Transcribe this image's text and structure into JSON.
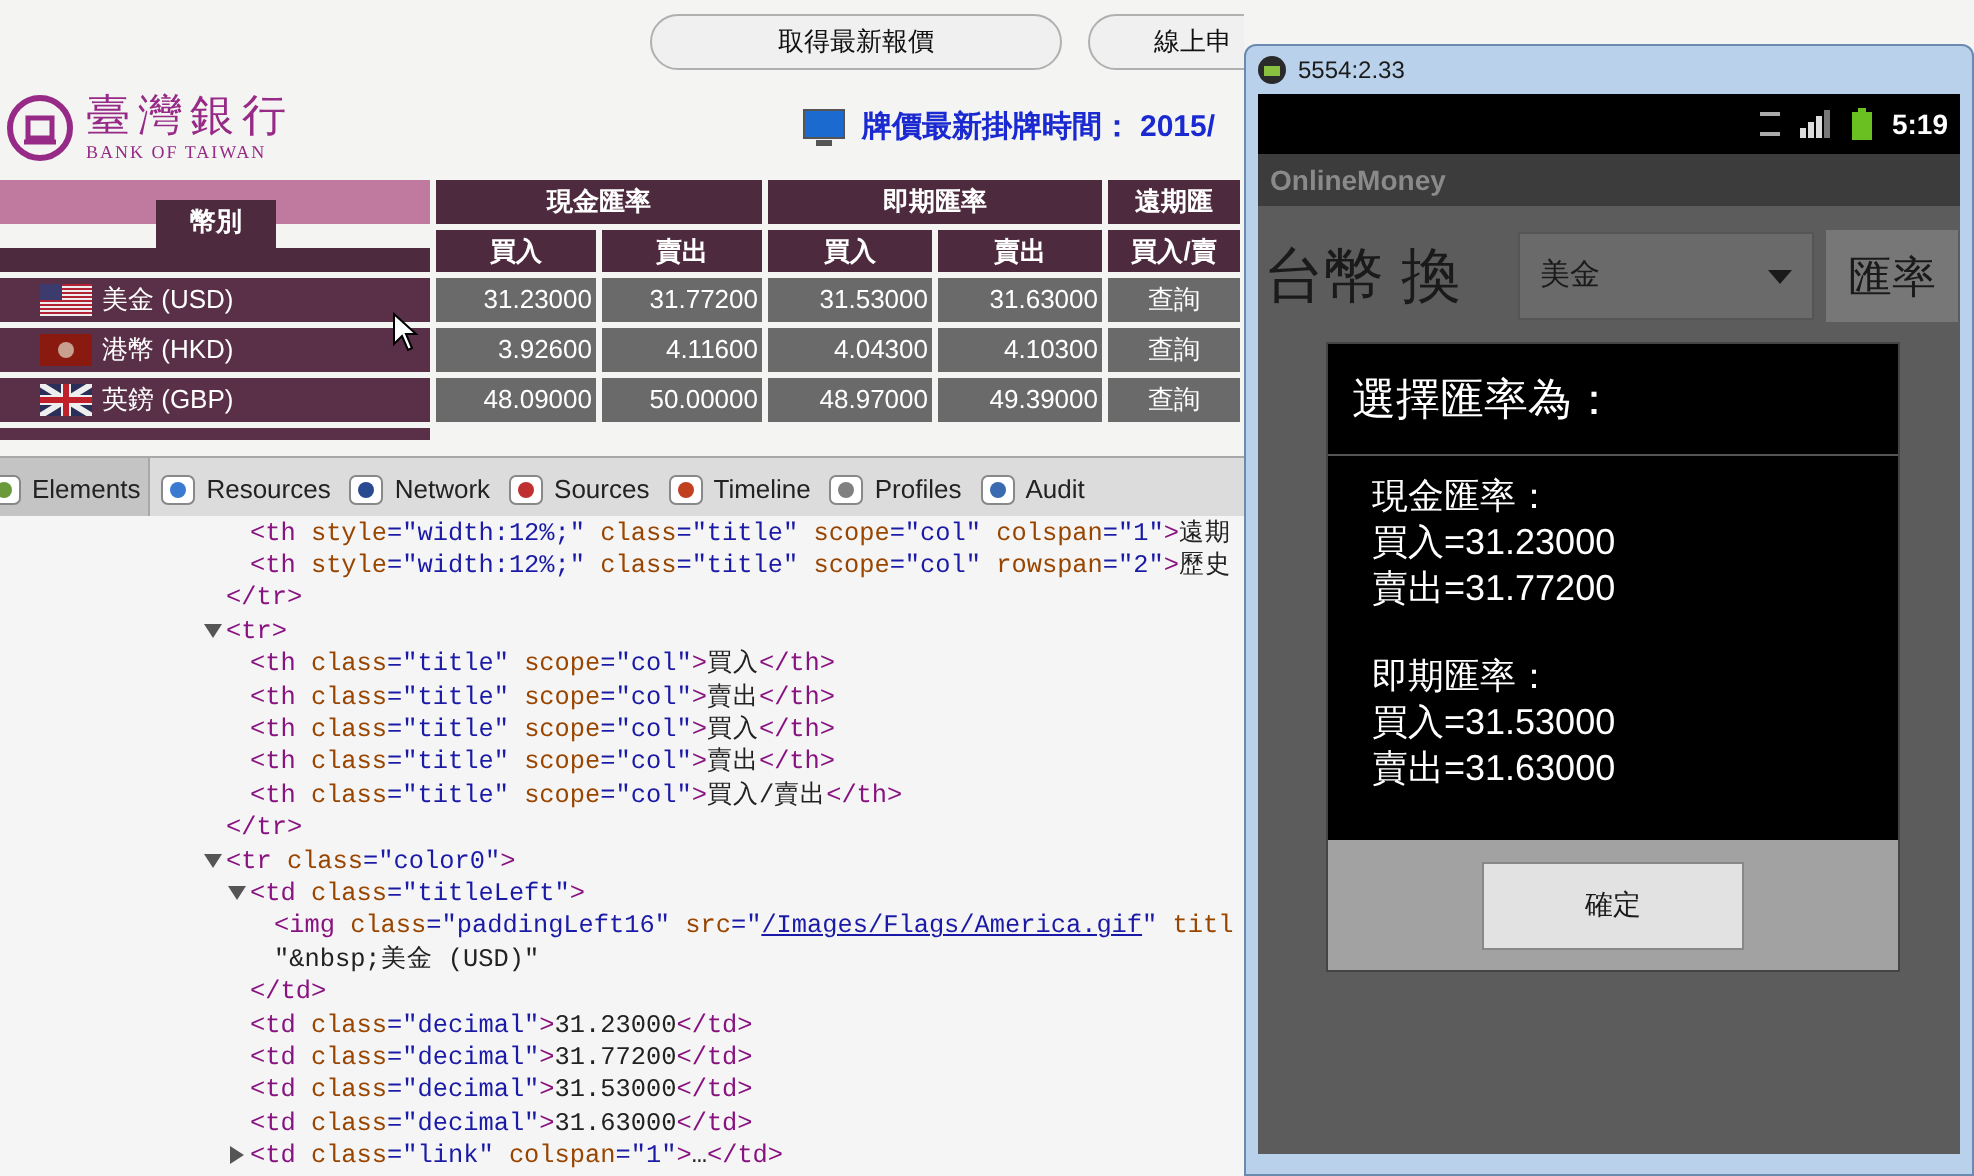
{
  "browser": {
    "buttons": [
      {
        "label": "取得最新報價"
      },
      {
        "label": "線上申"
      }
    ],
    "logo": {
      "name": "臺灣銀行",
      "subtitle": "BANK OF TAIWAN"
    },
    "update_time": {
      "label": "牌價最新掛牌時間：",
      "value": "2015/"
    },
    "rate_table": {
      "currency_header": "幣別",
      "groups": [
        {
          "label": "現金匯率",
          "columns": [
            "買入",
            "賣出"
          ]
        },
        {
          "label": "即期匯率",
          "columns": [
            "買入",
            "賣出"
          ]
        },
        {
          "label": "遠期匯",
          "columns": [
            "買入/賣"
          ]
        }
      ],
      "rows": [
        {
          "currency": "美金 (USD)",
          "kind": "us",
          "values": [
            "31.23000",
            "31.77200",
            "31.53000",
            "31.63000"
          ],
          "link": "查詢"
        },
        {
          "currency": "港幣 (HKD)",
          "kind": "hk",
          "values": [
            "3.92600",
            "4.11600",
            "4.04300",
            "4.10300"
          ],
          "link": "查詢"
        },
        {
          "currency": "英鎊 (GBP)",
          "kind": "gb",
          "values": [
            "48.09000",
            "50.00000",
            "48.97000",
            "49.39000"
          ],
          "link": "查詢"
        }
      ]
    }
  },
  "devtools": {
    "tabs": [
      {
        "label": "Elements",
        "selected": true
      },
      {
        "label": "Resources",
        "selected": false
      },
      {
        "label": "Network",
        "selected": false
      },
      {
        "label": "Sources",
        "selected": false
      },
      {
        "label": "Timeline",
        "selected": false
      },
      {
        "label": "Profiles",
        "selected": false
      },
      {
        "label": "Audit",
        "selected": false
      }
    ],
    "tree": [
      {
        "children": [
          {
            "tokens": [
              {
                "kind": "tag",
                "text": "<th"
              },
              {
                "kind": "attr",
                "text": " style"
              },
              {
                "kind": "value",
                "text": "=\"width:12%;\""
              },
              {
                "kind": "attr",
                "text": " class"
              },
              {
                "kind": "value",
                "text": "=\"title\""
              },
              {
                "kind": "attr",
                "text": " scope"
              },
              {
                "kind": "value",
                "text": "=\"col\""
              },
              {
                "kind": "attr",
                "text": " colspan"
              },
              {
                "kind": "value",
                "text": "=\"1\""
              },
              {
                "kind": "tag",
                "text": ">"
              },
              {
                "kind": "text",
                "text": "遠期"
              }
            ]
          },
          {
            "tokens": [
              {
                "kind": "tag",
                "text": "<th"
              },
              {
                "kind": "attr",
                "text": " style"
              },
              {
                "kind": "value",
                "text": "=\"width:12%;\""
              },
              {
                "kind": "attr",
                "text": " class"
              },
              {
                "kind": "value",
                "text": "=\"title\""
              },
              {
                "kind": "attr",
                "text": " scope"
              },
              {
                "kind": "value",
                "text": "=\"col\""
              },
              {
                "kind": "attr",
                "text": " rowspan"
              },
              {
                "kind": "value",
                "text": "=\"2\""
              },
              {
                "kind": "tag",
                "text": ">"
              },
              {
                "kind": "text",
                "text": "歷史"
              }
            ]
          }
        ],
        "closing": [
          {
            "kind": "tag",
            "text": "</tr>"
          }
        ]
      },
      {
        "tokens": [
          {
            "kind": "tag",
            "text": "<tr>"
          }
        ],
        "expanded": true,
        "children": [
          {
            "tokens": [
              {
                "kind": "tag",
                "text": "<th"
              },
              {
                "kind": "attr",
                "text": " class"
              },
              {
                "kind": "value",
                "text": "=\"title\""
              },
              {
                "kind": "attr",
                "text": " scope"
              },
              {
                "kind": "value",
                "text": "=\"col\""
              },
              {
                "kind": "tag",
                "text": ">"
              },
              {
                "kind": "text",
                "text": "買入"
              },
              {
                "kind": "tag",
                "text": "</th>"
              }
            ]
          },
          {
            "tokens": [
              {
                "kind": "tag",
                "text": "<th"
              },
              {
                "kind": "attr",
                "text": " class"
              },
              {
                "kind": "value",
                "text": "=\"title\""
              },
              {
                "kind": "attr",
                "text": " scope"
              },
              {
                "kind": "value",
                "text": "=\"col\""
              },
              {
                "kind": "tag",
                "text": ">"
              },
              {
                "kind": "text",
                "text": "賣出"
              },
              {
                "kind": "tag",
                "text": "</th>"
              }
            ]
          },
          {
            "tokens": [
              {
                "kind": "tag",
                "text": "<th"
              },
              {
                "kind": "attr",
                "text": " class"
              },
              {
                "kind": "value",
                "text": "=\"title\""
              },
              {
                "kind": "attr",
                "text": " scope"
              },
              {
                "kind": "value",
                "text": "=\"col\""
              },
              {
                "kind": "tag",
                "text": ">"
              },
              {
                "kind": "text",
                "text": "買入"
              },
              {
                "kind": "tag",
                "text": "</th>"
              }
            ]
          },
          {
            "tokens": [
              {
                "kind": "tag",
                "text": "<th"
              },
              {
                "kind": "attr",
                "text": " class"
              },
              {
                "kind": "value",
                "text": "=\"title\""
              },
              {
                "kind": "attr",
                "text": " scope"
              },
              {
                "kind": "value",
                "text": "=\"col\""
              },
              {
                "kind": "tag",
                "text": ">"
              },
              {
                "kind": "text",
                "text": "賣出"
              },
              {
                "kind": "tag",
                "text": "</th>"
              }
            ]
          },
          {
            "tokens": [
              {
                "kind": "tag",
                "text": "<th"
              },
              {
                "kind": "attr",
                "text": " class"
              },
              {
                "kind": "value",
                "text": "=\"title\""
              },
              {
                "kind": "attr",
                "text": " scope"
              },
              {
                "kind": "value",
                "text": "=\"col\""
              },
              {
                "kind": "tag",
                "text": ">"
              },
              {
                "kind": "text",
                "text": "買入/賣出"
              },
              {
                "kind": "tag",
                "text": "</th>"
              }
            ]
          }
        ],
        "closing": [
          {
            "kind": "tag",
            "text": "</tr>"
          }
        ]
      },
      {
        "tokens": [
          {
            "kind": "tag",
            "text": "<tr"
          },
          {
            "kind": "attr",
            "text": " class"
          },
          {
            "kind": "value",
            "text": "=\"color0\""
          },
          {
            "kind": "tag",
            "text": ">"
          }
        ],
        "expanded": true,
        "children": [
          {
            "tokens": [
              {
                "kind": "tag",
                "text": "<td"
              },
              {
                "kind": "attr",
                "text": " class"
              },
              {
                "kind": "value",
                "text": "=\"titleLeft\""
              },
              {
                "kind": "tag",
                "text": ">"
              }
            ],
            "expanded": true,
            "children": [
              {
                "tokens": [
                  {
                    "kind": "tag",
                    "text": "<img"
                  },
                  {
                    "kind": "attr",
                    "text": " class"
                  },
                  {
                    "kind": "value",
                    "text": "=\"paddingLeft16\""
                  },
                  {
                    "kind": "attr",
                    "text": " src"
                  },
                  {
                    "kind": "value",
                    "text": "=\""
                  },
                  {
                    "kind": "link",
                    "text": "/Images/Flags/America.gif"
                  },
                  {
                    "kind": "value",
                    "text": "\""
                  },
                  {
                    "kind": "attr",
                    "text": " titl"
                  }
                ]
              },
              {
                "tokens": [
                  {
                    "kind": "text",
                    "text": "\"&nbsp;美金 (USD)\""
                  }
                ]
              }
            ],
            "closing": [
              {
                "kind": "tag",
                "text": "</td>"
              }
            ]
          },
          {
            "tokens": [
              {
                "kind": "tag",
                "text": "<td"
              },
              {
                "kind": "attr",
                "text": " class"
              },
              {
                "kind": "value",
                "text": "=\"decimal\""
              },
              {
                "kind": "tag",
                "text": ">"
              },
              {
                "kind": "text",
                "text": "31.23000"
              },
              {
                "kind": "tag",
                "text": "</td>"
              }
            ]
          },
          {
            "tokens": [
              {
                "kind": "tag",
                "text": "<td"
              },
              {
                "kind": "attr",
                "text": " class"
              },
              {
                "kind": "value",
                "text": "=\"decimal\""
              },
              {
                "kind": "tag",
                "text": ">"
              },
              {
                "kind": "text",
                "text": "31.77200"
              },
              {
                "kind": "tag",
                "text": "</td>"
              }
            ]
          },
          {
            "tokens": [
              {
                "kind": "tag",
                "text": "<td"
              },
              {
                "kind": "attr",
                "text": " class"
              },
              {
                "kind": "value",
                "text": "=\"decimal\""
              },
              {
                "kind": "tag",
                "text": ">"
              },
              {
                "kind": "text",
                "text": "31.53000"
              },
              {
                "kind": "tag",
                "text": "</td>"
              }
            ]
          },
          {
            "tokens": [
              {
                "kind": "tag",
                "text": "<td"
              },
              {
                "kind": "attr",
                "text": " class"
              },
              {
                "kind": "value",
                "text": "=\"decimal\""
              },
              {
                "kind": "tag",
                "text": ">"
              },
              {
                "kind": "text",
                "text": "31.63000"
              },
              {
                "kind": "tag",
                "text": "</td>"
              }
            ]
          },
          {
            "tokens": [
              {
                "kind": "tag",
                "text": "<td"
              },
              {
                "kind": "attr",
                "text": " class"
              },
              {
                "kind": "value",
                "text": "=\"link\""
              },
              {
                "kind": "attr",
                "text": " colspan"
              },
              {
                "kind": "value",
                "text": "=\"1\""
              },
              {
                "kind": "tag",
                "text": ">"
              },
              {
                "kind": "text",
                "text": "…"
              },
              {
                "kind": "tag",
                "text": "</td>"
              }
            ],
            "expanded": false
          }
        ]
      }
    ]
  },
  "emulator": {
    "title": "5554:2.33",
    "status_time": "5:19",
    "app_title": "OnlineMoney",
    "prompt": "台幣 換",
    "spinner": "美金",
    "button": "匯率",
    "dialog": {
      "title": "選擇匯率為：",
      "sections": [
        {
          "heading": "現金匯率：",
          "lines": [
            "買入=31.23000",
            "賣出=31.77200"
          ]
        },
        {
          "heading": "即期匯率：",
          "lines": [
            "買入=31.53000",
            "賣出=31.63000"
          ]
        }
      ],
      "button": "確定"
    }
  }
}
